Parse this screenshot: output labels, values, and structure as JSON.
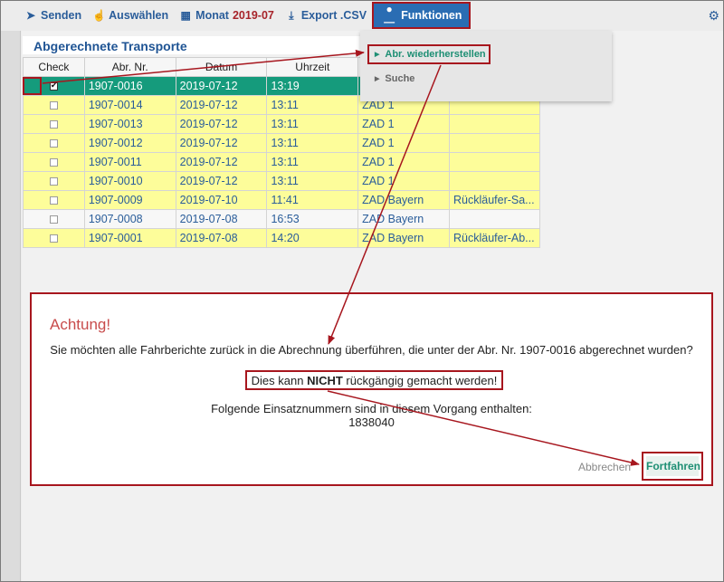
{
  "toolbar": {
    "send_label": "Senden",
    "select_label": "Auswählen",
    "month_label": "Monat",
    "month_value": "2019-07",
    "export_label": "Export .CSV",
    "functions_label": "Funktionen"
  },
  "dropdown": {
    "restore_label": "Abr. wiederherstellen",
    "search_label": "Suche"
  },
  "panel": {
    "title": "Abgerechnete Transporte"
  },
  "table": {
    "headers": {
      "check": "Check",
      "abr_nr": "Abr. Nr.",
      "datum": "Datum",
      "uhrzeit": "Uhrzeit"
    },
    "rows": [
      {
        "abr_nr": "1907-0016",
        "datum": "2019-07-12",
        "uhrzeit": "13:19",
        "col5": "",
        "col6": "",
        "checked": true,
        "style": "green"
      },
      {
        "abr_nr": "1907-0014",
        "datum": "2019-07-12",
        "uhrzeit": "13:11",
        "col5": "ZAD 1",
        "col6": "",
        "checked": false,
        "style": "yellow"
      },
      {
        "abr_nr": "1907-0013",
        "datum": "2019-07-12",
        "uhrzeit": "13:11",
        "col5": "ZAD 1",
        "col6": "",
        "checked": false,
        "style": "yellow"
      },
      {
        "abr_nr": "1907-0012",
        "datum": "2019-07-12",
        "uhrzeit": "13:11",
        "col5": "ZAD 1",
        "col6": "",
        "checked": false,
        "style": "yellow"
      },
      {
        "abr_nr": "1907-0011",
        "datum": "2019-07-12",
        "uhrzeit": "13:11",
        "col5": "ZAD 1",
        "col6": "",
        "checked": false,
        "style": "yellow"
      },
      {
        "abr_nr": "1907-0010",
        "datum": "2019-07-12",
        "uhrzeit": "13:11",
        "col5": "ZAD 1",
        "col6": "",
        "checked": false,
        "style": "yellow"
      },
      {
        "abr_nr": "1907-0009",
        "datum": "2019-07-10",
        "uhrzeit": "11:41",
        "col5": "ZAD Bayern",
        "col6": "Rückläufer-Sa...",
        "checked": false,
        "style": "yellow"
      },
      {
        "abr_nr": "1907-0008",
        "datum": "2019-07-08",
        "uhrzeit": "16:53",
        "col5": "ZAD Bayern",
        "col6": "",
        "checked": false,
        "style": "white"
      },
      {
        "abr_nr": "1907-0001",
        "datum": "2019-07-08",
        "uhrzeit": "14:20",
        "col5": "ZAD Bayern",
        "col6": "Rückläufer-Ab...",
        "checked": false,
        "style": "yellow"
      }
    ]
  },
  "dialog": {
    "title": "Achtung!",
    "message": "Sie möchten alle Fahrberichte zurück in die Abrechnung überführen, die unter der Abr. Nr. 1907-0016 abgerechnet wurden?",
    "warn_pre": "Dies kann ",
    "warn_strong": "NICHT",
    "warn_post": " rückgängig gemacht werden!",
    "info_line1": "Folgende Einsatznummern sind in diesem Vorgang enthalten:",
    "info_line2": "1838040",
    "cancel_label": "Abbrechen",
    "continue_label": "Fortfahren"
  },
  "colors": {
    "accent_blue": "#2a6db3",
    "highlight_red": "#a7161e",
    "selected_green": "#159b7c",
    "row_yellow": "#fdfd9a",
    "warning_title": "#c84c4c"
  }
}
